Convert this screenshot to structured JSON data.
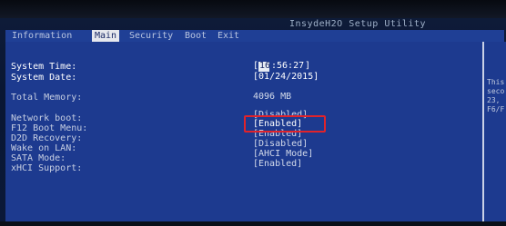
{
  "app": {
    "title": "InsydeH2O Setup Utility"
  },
  "menubar": {
    "tabs": [
      {
        "label": "Information"
      },
      {
        "label": "Main",
        "active": true
      },
      {
        "label": "Security"
      },
      {
        "label": "Boot"
      },
      {
        "label": "Exit"
      }
    ]
  },
  "main": {
    "system_time_label": "System Time:",
    "system_time_hour": "16",
    "system_time_rest": ":56:27",
    "system_date_label": "System Date:",
    "system_date_value": "[01/24/2015]",
    "total_memory_label": "Total Memory:",
    "total_memory_value": "4096 MB",
    "settings": [
      {
        "label": "Network boot:",
        "value": "[Disabled]"
      },
      {
        "label": "F12 Boot Menu:",
        "value": "[Enabled]"
      },
      {
        "label": "D2D Recovery:",
        "value": "[Enabled]"
      },
      {
        "label": "Wake on LAN:",
        "value": "[Disabled]"
      },
      {
        "label": "SATA Mode:",
        "value": "[AHCI Mode]"
      },
      {
        "label": "xHCI Support:",
        "value": "[Enabled]"
      }
    ]
  },
  "help_panel": {
    "lines": [
      "This",
      "seco",
      "23,",
      "F6/F"
    ]
  },
  "colors": {
    "panel_blue": "#1d3a8f",
    "menubar_blue": "#1f3f95",
    "highlight_box": "#e0232b"
  }
}
